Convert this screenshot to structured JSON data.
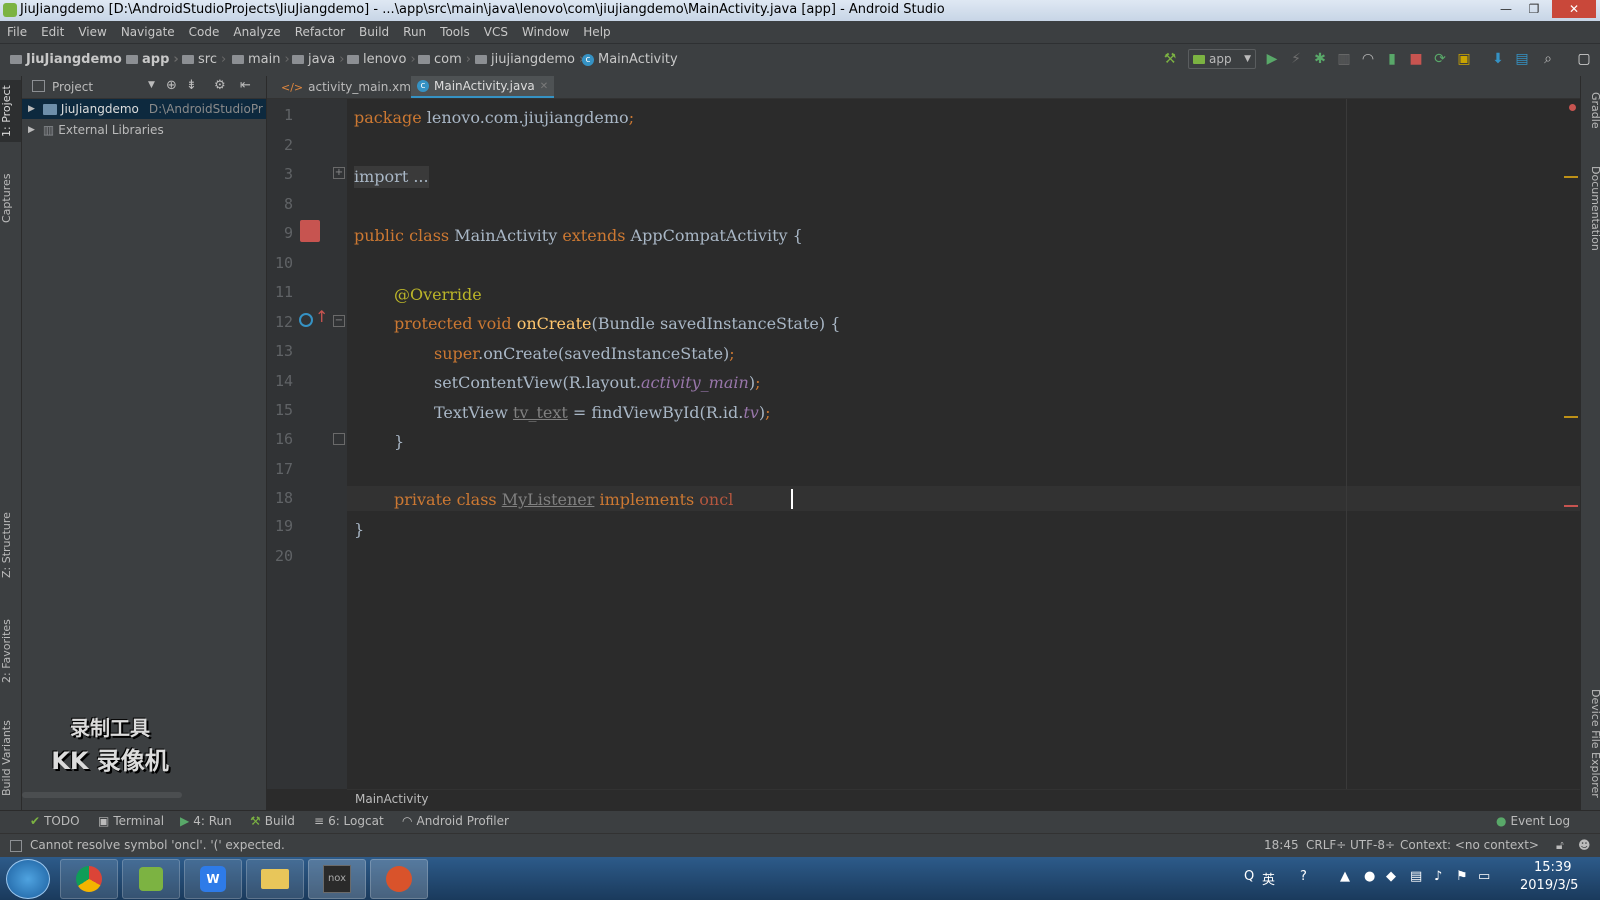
{
  "window": {
    "title": "JiuJiangdemo [D:\\AndroidStudioProjects\\JiuJiangdemo] - ...\\app\\src\\main\\java\\lenovo\\com\\jiujiangdemo\\MainActivity.java [app] - Android Studio",
    "minimize": "—",
    "maximize": "❐",
    "close": "✕"
  },
  "menu": [
    "File",
    "Edit",
    "View",
    "Navigate",
    "Code",
    "Analyze",
    "Refactor",
    "Build",
    "Run",
    "Tools",
    "VCS",
    "Window",
    "Help"
  ],
  "breadcrumbs": [
    "JiuJiangdemo",
    "app",
    "src",
    "main",
    "java",
    "lenovo",
    "com",
    "jiujiangdemo",
    "MainActivity"
  ],
  "run_config": "app",
  "left_tabs": {
    "project": "1: Project",
    "captures": "Captures",
    "structure": "Z: Structure",
    "favorites": "2: Favorites",
    "build_variants": "Build Variants"
  },
  "right_tabs": {
    "gradle": "Gradle",
    "documentation": "Documentation",
    "device_explorer": "Device File Explorer"
  },
  "project_panel": {
    "view": "Project",
    "root_name": "JiuJiangdemo",
    "root_path": "D:\\AndroidStudioPr",
    "external": "External Libraries"
  },
  "editor_tabs": [
    {
      "label": "activity_main.xml",
      "active": false
    },
    {
      "label": "MainActivity.java",
      "active": true
    }
  ],
  "line_numbers": [
    "1",
    "2",
    "3",
    "8",
    "9",
    "10",
    "11",
    "12",
    "13",
    "14",
    "15",
    "16",
    "17",
    "18",
    "19",
    "20"
  ],
  "code": {
    "l1": {
      "kw": "package",
      "rest": " lenovo.com.jiujiangdemo",
      "semi": ";"
    },
    "l3": {
      "text": "import ..."
    },
    "l9": {
      "kw1": "public class",
      "name": " MainActivity ",
      "kw2": "extends",
      "rest": " AppCompatActivity {"
    },
    "l11": {
      "text": "@Override"
    },
    "l12": {
      "kw": "protected void",
      "fn": " onCreate",
      "rest": "(Bundle savedInstanceState) {"
    },
    "l13": {
      "kw": "super",
      "rest": ".onCreate(savedInstanceState)",
      "semi": ";"
    },
    "l14": {
      "pre": "setContentView(R.layout.",
      "it": "activity_main",
      "post": ")",
      "semi": ";"
    },
    "l15": {
      "pre": "TextView ",
      "un": "tv_text",
      "mid": " = findViewById(R.id.",
      "it": "tv",
      "post": ")",
      "semi": ";"
    },
    "l16": {
      "text": "}"
    },
    "l18": {
      "kw1": "private class",
      "un": "MyListener",
      "kw2": "implements",
      "typed": "oncl"
    },
    "l19": {
      "text": "}"
    }
  },
  "editor_breadcrumb": "MainActivity",
  "tool_windows": [
    "TODO",
    "Terminal",
    "4: Run",
    "Build",
    "6: Logcat",
    "Android Profiler"
  ],
  "event_log": "Event Log",
  "status": {
    "message": "Cannot resolve symbol 'oncl'. '(' expected.",
    "position": "18:45",
    "line_sep": "CRLF÷",
    "encoding": "UTF-8÷",
    "context": "Context: <no context>"
  },
  "watermark": {
    "line1": "录制工具",
    "line2": "KK 录像机"
  },
  "taskbar": {
    "apps": [
      "start",
      "chrome",
      "android-studio",
      "wps",
      "explorer",
      "nox",
      "player"
    ],
    "tray_ime": "英",
    "time": "15:39",
    "date": "2019/3/5"
  },
  "colors": {
    "keyword": "#cc7832",
    "annotation": "#bbb529",
    "function": "#ffc66d",
    "field": "#9876aa",
    "text": "#a9b7c6",
    "background": "#2b2b2b"
  }
}
